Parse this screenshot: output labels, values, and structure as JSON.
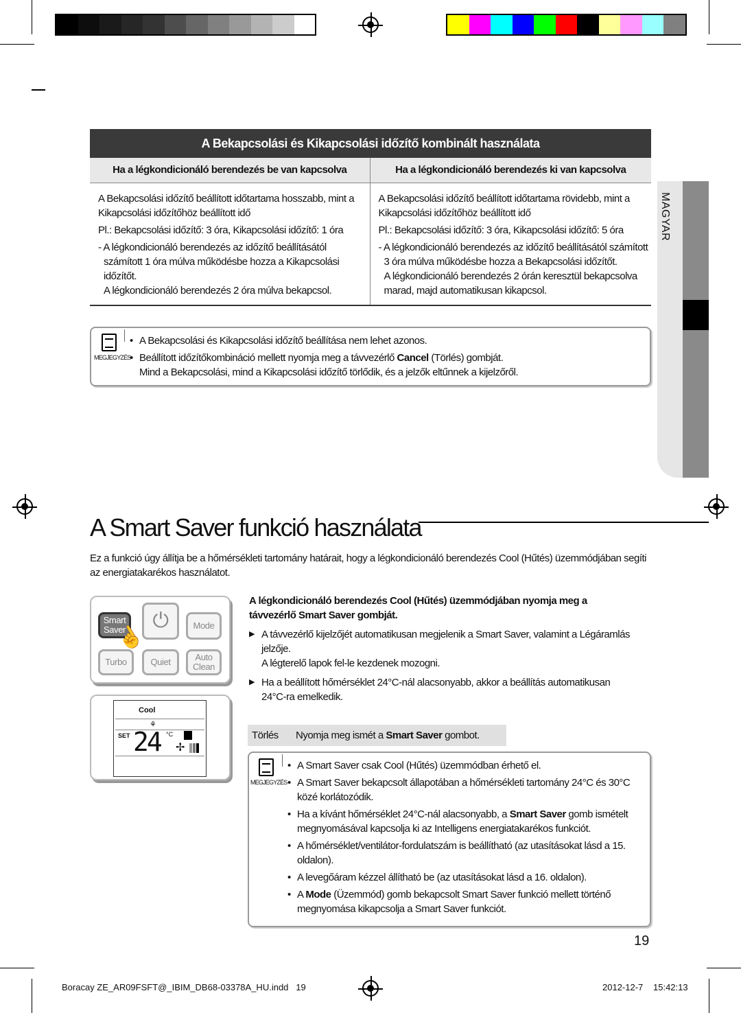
{
  "colors": {
    "header_bg": "#3a3a3a",
    "subheader_bg": "#e8e8e8",
    "side_tab": "#8a8a8a",
    "cancel_bar": "#e0e0e0"
  },
  "gray_swatches": [
    "#000000",
    "#0d0d0d",
    "#1a1a1a",
    "#262626",
    "#333333",
    "#4d4d4d",
    "#666666",
    "#808080",
    "#999999",
    "#b3b3b3",
    "#cccccc",
    "#ffffff"
  ],
  "color_swatches": [
    "#ffff00",
    "#ff00ff",
    "#00ffff",
    "#0000ff",
    "#00ff00",
    "#ff0000",
    "#000000",
    "#ffff99",
    "#ff99ff",
    "#99ffff",
    "#808080"
  ],
  "side_tab": {
    "label": "MAGYAR"
  },
  "timer_section": {
    "title": "A Bekapcsolási és Kikapcsolási időzítő kombinált használata",
    "columns": [
      {
        "header": "Ha a légkondicionáló berendezés be van kapcsolva",
        "lines": [
          "A Bekapcsolási időzítő beállított időtartama hosszabb, mint a Kikapcsolási időzítőhöz beállított idő",
          "Pl.: Bekapcsolási időzítő: 3 óra, Kikapcsolási időzítő: 1 óra",
          "- A légkondicionáló berendezés az időzítő beállításától számított 1 óra múlva működésbe hozza a Kikapcsolási időzítőt.",
          "A légkondicionáló berendezés 2 óra múlva bekapcsol."
        ]
      },
      {
        "header": "Ha a légkondicionáló berendezés ki van kapcsolva",
        "lines": [
          "A Bekapcsolási időzítő beállított időtartama rövidebb, mint a Kikapcsolási időzítőhöz beállított idő",
          "Pl.: Bekapcsolási időzítő: 3 óra, Kikapcsolási időzítő: 5 óra",
          "- A légkondicionáló berendezés az időzítő beállításától számított 3 óra múlva működésbe hozza a Bekapcsolási időzítőt.",
          "A légkondicionáló berendezés 2 órán keresztül bekapcsolva marad, majd automatikusan kikapcsol."
        ]
      }
    ],
    "note": {
      "icon_label": "MEGJEGYZÉS",
      "items": [
        "A Bekapcsolási és Kikapcsolási időzítő beállítása nem lehet azonos."
      ],
      "item2_pre": "Beállított időzítőkombináció mellett nyomja meg a távvezérlő ",
      "item2_bold": "Cancel",
      "item2_post": " (Törlés) gombját.",
      "item2_line2": "Mind a Bekapcsolási, mind a Kikapcsolási időzítő törlődik, és a jelzők eltűnnek a kijelzőről."
    }
  },
  "smart_saver": {
    "title": "A Smart Saver funkció használata",
    "intro": "Ez a funkció úgy állítja be a hőmérsékleti tartomány határait, hogy a légkondicionáló berendezés Cool (Hűtés) üzemmódjában segíti az energiatakarékos használatot.",
    "instruction_bold_1": "A légkondicionáló berendezés Cool (Hűtés) üzemmódjában nyomja meg a",
    "instruction_bold_2": "távvezérlő Smart Saver gombját.",
    "steps": [
      {
        "text": "A távvezérlő kijelzőjét automatikusan megjelenik a Smart Saver, valamint a Légáramlás jelzője.",
        "sub": "A légterelő lapok fel-le kezdenek mozogni."
      },
      {
        "text": "Ha a beállított hőmérséklet 24°C-nál alacsonyabb, akkor a beállítás automatikusan 24°C-ra emelkedik.",
        "sub": ""
      }
    ],
    "cancel": {
      "label": "Törlés",
      "pre": "Nyomja meg ismét a ",
      "bold": "Smart Saver",
      "post": " gombot."
    },
    "note": {
      "icon_label": "MEGJEGYZÉS",
      "items": [
        "A Smart Saver csak Cool (Hűtés) üzemmódban érhető el.",
        "A Smart Saver bekapcsolt állapotában a hőmérsékleti tartomány 24°C és 30°C közé korlátozódik.",
        "A hőmérséklet/ventilátor-fordulatszám is beállítható (az utasításokat lásd a 15. oldalon).",
        "A levegőáram kézzel állítható be (az utasításokat lásd a 16. oldalon)."
      ],
      "item3_pre": "Ha a kívánt hőmérséklet 24°C-nál alacsonyabb, a ",
      "item3_bold": "Smart Saver",
      "item3_post": " gomb ismételt megnyomásával kapcsolja ki az Intelligens energiatakarékos funkciót.",
      "item6_pre": "A ",
      "item6_bold": "Mode",
      "item6_post": " (Üzemmód) gomb bekapcsolt Smart Saver funkció mellett történő megnyomása kikapcsolja a Smart Saver funkciót."
    },
    "remote": {
      "buttons": {
        "smart_saver": "Smart Saver",
        "mode": "Mode",
        "turbo": "Turbo",
        "quiet": "Quiet",
        "auto_clean": "Auto Clean"
      },
      "display": {
        "mode": "Cool",
        "set": "SET",
        "temperature": "24",
        "unit": "°C"
      }
    }
  },
  "page_number": "19",
  "footer": {
    "file": "Boracay ZE_AR09FSFT@_IBIM_DB68-03378A_HU.indd   19",
    "date": "2012-12-7",
    "time": "15:42:13"
  }
}
